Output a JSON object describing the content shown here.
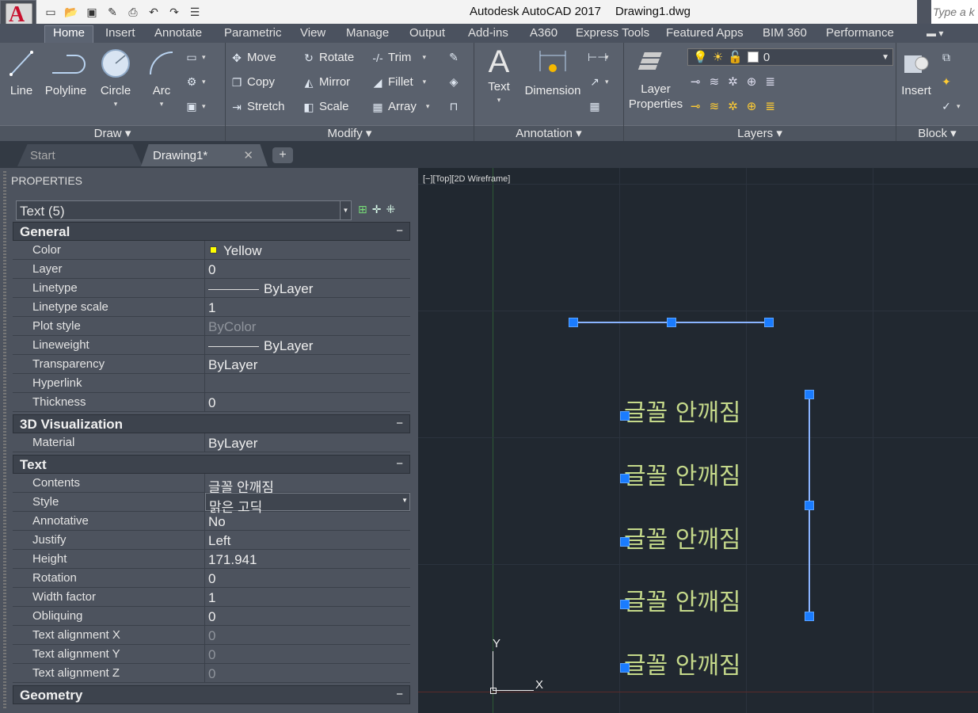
{
  "titlebar": {
    "app": "Autodesk AutoCAD 2017",
    "file": "Drawing1.dwg",
    "search_placeholder": "Type a k"
  },
  "ribbon_tabs": [
    "Home",
    "Insert",
    "Annotate",
    "Parametric",
    "View",
    "Manage",
    "Output",
    "Add-ins",
    "A360",
    "Express Tools",
    "Featured Apps",
    "BIM 360",
    "Performance"
  ],
  "ribbon": {
    "draw": {
      "title": "Draw",
      "line": "Line",
      "polyline": "Polyline",
      "circle": "Circle",
      "arc": "Arc"
    },
    "modify": {
      "title": "Modify",
      "move": "Move",
      "rotate": "Rotate",
      "trim": "Trim",
      "copy": "Copy",
      "mirror": "Mirror",
      "fillet": "Fillet",
      "stretch": "Stretch",
      "scale": "Scale",
      "array": "Array"
    },
    "annotation": {
      "title": "Annotation",
      "text": "Text",
      "dimension": "Dimension"
    },
    "layers": {
      "title": "Layers",
      "layer_properties_1": "Layer",
      "layer_properties_2": "Properties",
      "current_layer": "0"
    },
    "block": {
      "title": "Block",
      "insert": "Insert"
    }
  },
  "doc_tabs": {
    "start": "Start",
    "drawing": "Drawing1*"
  },
  "properties": {
    "title": "PROPERTIES",
    "selection": "Text (5)",
    "general": {
      "title": "General",
      "rows": [
        {
          "k": "Color",
          "v": "Yellow"
        },
        {
          "k": "Layer",
          "v": "0"
        },
        {
          "k": "Linetype",
          "v": "ByLayer"
        },
        {
          "k": "Linetype scale",
          "v": "1"
        },
        {
          "k": "Plot style",
          "v": "ByColor"
        },
        {
          "k": "Lineweight",
          "v": "ByLayer"
        },
        {
          "k": "Transparency",
          "v": "ByLayer"
        },
        {
          "k": "Hyperlink",
          "v": ""
        },
        {
          "k": "Thickness",
          "v": "0"
        }
      ]
    },
    "viz": {
      "title": "3D Visualization",
      "rows": [
        {
          "k": "Material",
          "v": "ByLayer"
        }
      ]
    },
    "text": {
      "title": "Text",
      "rows": [
        {
          "k": "Contents",
          "v": "글꼴 안깨짐"
        },
        {
          "k": "Style",
          "v": "맑은 고딕"
        },
        {
          "k": "Annotative",
          "v": "No"
        },
        {
          "k": "Justify",
          "v": "Left"
        },
        {
          "k": "Height",
          "v": "171.941"
        },
        {
          "k": "Rotation",
          "v": "0"
        },
        {
          "k": "Width factor",
          "v": "1"
        },
        {
          "k": "Obliquing",
          "v": "0"
        },
        {
          "k": "Text alignment X",
          "v": "0"
        },
        {
          "k": "Text alignment Y",
          "v": "0"
        },
        {
          "k": "Text alignment Z",
          "v": "0"
        }
      ]
    },
    "geometry": {
      "title": "Geometry"
    }
  },
  "canvas": {
    "view_label": "[−][Top][2D Wireframe]",
    "texts": [
      "글꼴 안깨짐",
      "글꼴 안깨짐",
      "글꼴 안깨짐",
      "글꼴 안깨짐",
      "글꼴 안깨짐"
    ],
    "ucs_x": "X",
    "ucs_y": "Y"
  },
  "colors": {
    "accent": "#1a7cff",
    "text_yellow": "#c5d98a",
    "background": "#212830"
  }
}
